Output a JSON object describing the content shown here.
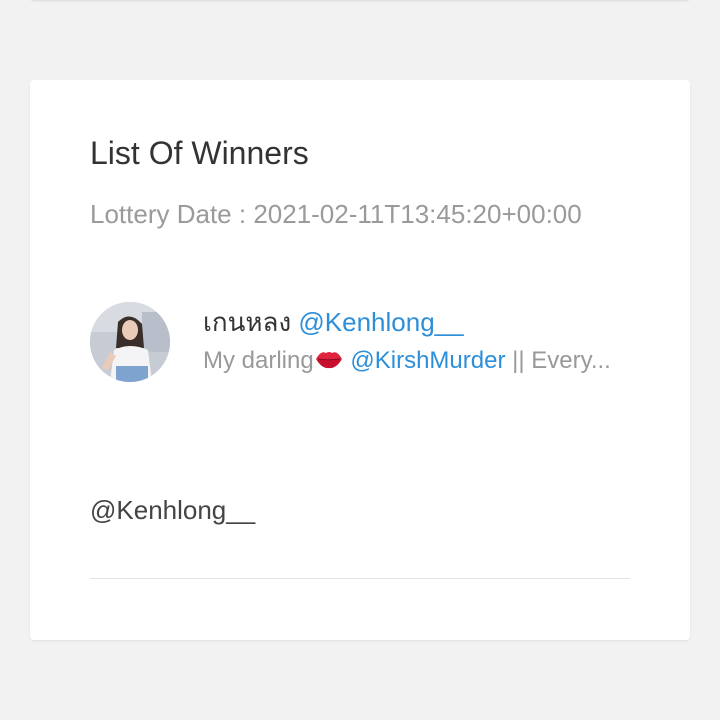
{
  "card": {
    "title": "List Of Winners",
    "lottery_date_label": "Lottery Date :",
    "lottery_date_value": "2021-02-11T13:45:20+00:00"
  },
  "winner": {
    "display_name": "เกนหลง",
    "handle": "@Kenhlong__",
    "bio_prefix": "My darling",
    "bio_icon": "kiss-mark-icon",
    "bio_mention": "@KirshMurder",
    "bio_suffix": "|| Every..."
  },
  "footer": {
    "handle": "@Kenhlong__"
  },
  "colors": {
    "background": "#f2f2f2",
    "card": "#ffffff",
    "link": "#2d8fd9",
    "muted_text": "#9a9a9a",
    "title_text": "#333333"
  }
}
